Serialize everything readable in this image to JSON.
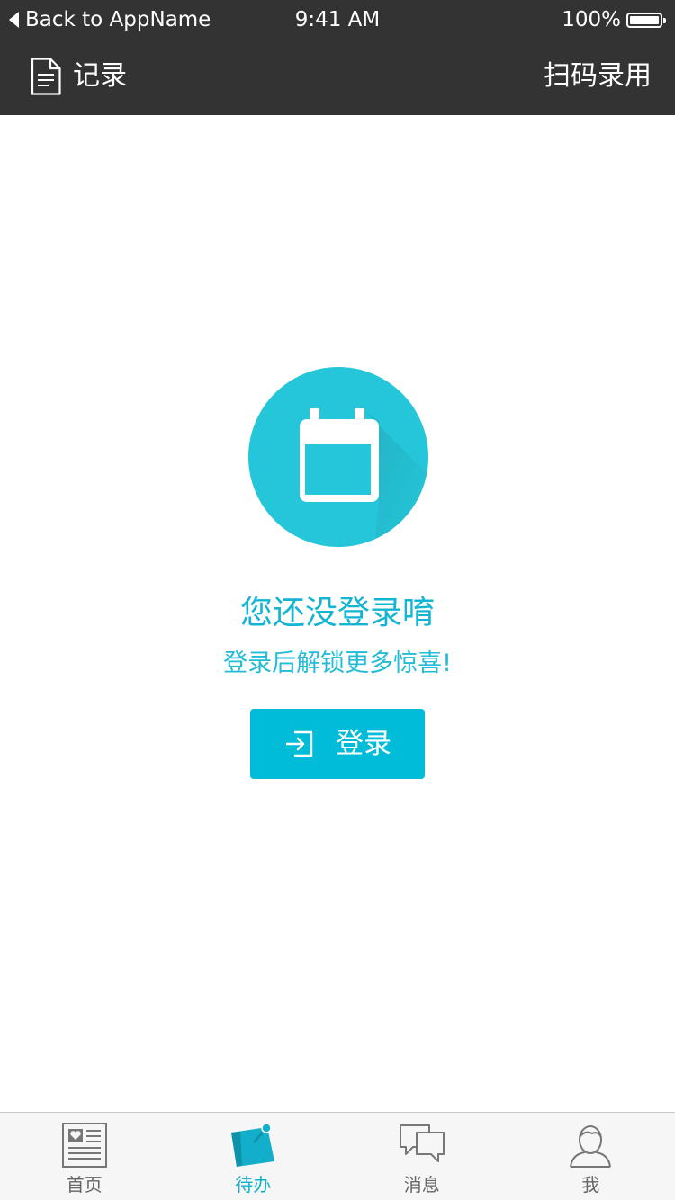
{
  "status_bar": {
    "back_label": "Back to AppName",
    "time": "9:41 AM",
    "battery": "100%"
  },
  "nav": {
    "left_label": "记录",
    "right_label": "扫码录用"
  },
  "empty_state": {
    "title": "您还没登录唷",
    "subtitle": "登录后解锁更多惊喜!",
    "button_label": "登录",
    "icon": "calendar-icon"
  },
  "tabs": [
    {
      "label": "首页",
      "icon": "news-icon",
      "active": false
    },
    {
      "label": "待办",
      "icon": "note-icon",
      "active": true
    },
    {
      "label": "消息",
      "icon": "chat-bubbles-icon",
      "active": false
    },
    {
      "label": "我",
      "icon": "user-icon",
      "active": false
    }
  ],
  "colors": {
    "bar_background": "#333333",
    "accent": "#00bcd8",
    "accent_text": "#13b5d2",
    "active_tab": "#13aec9",
    "inactive_tab": "#666666"
  }
}
